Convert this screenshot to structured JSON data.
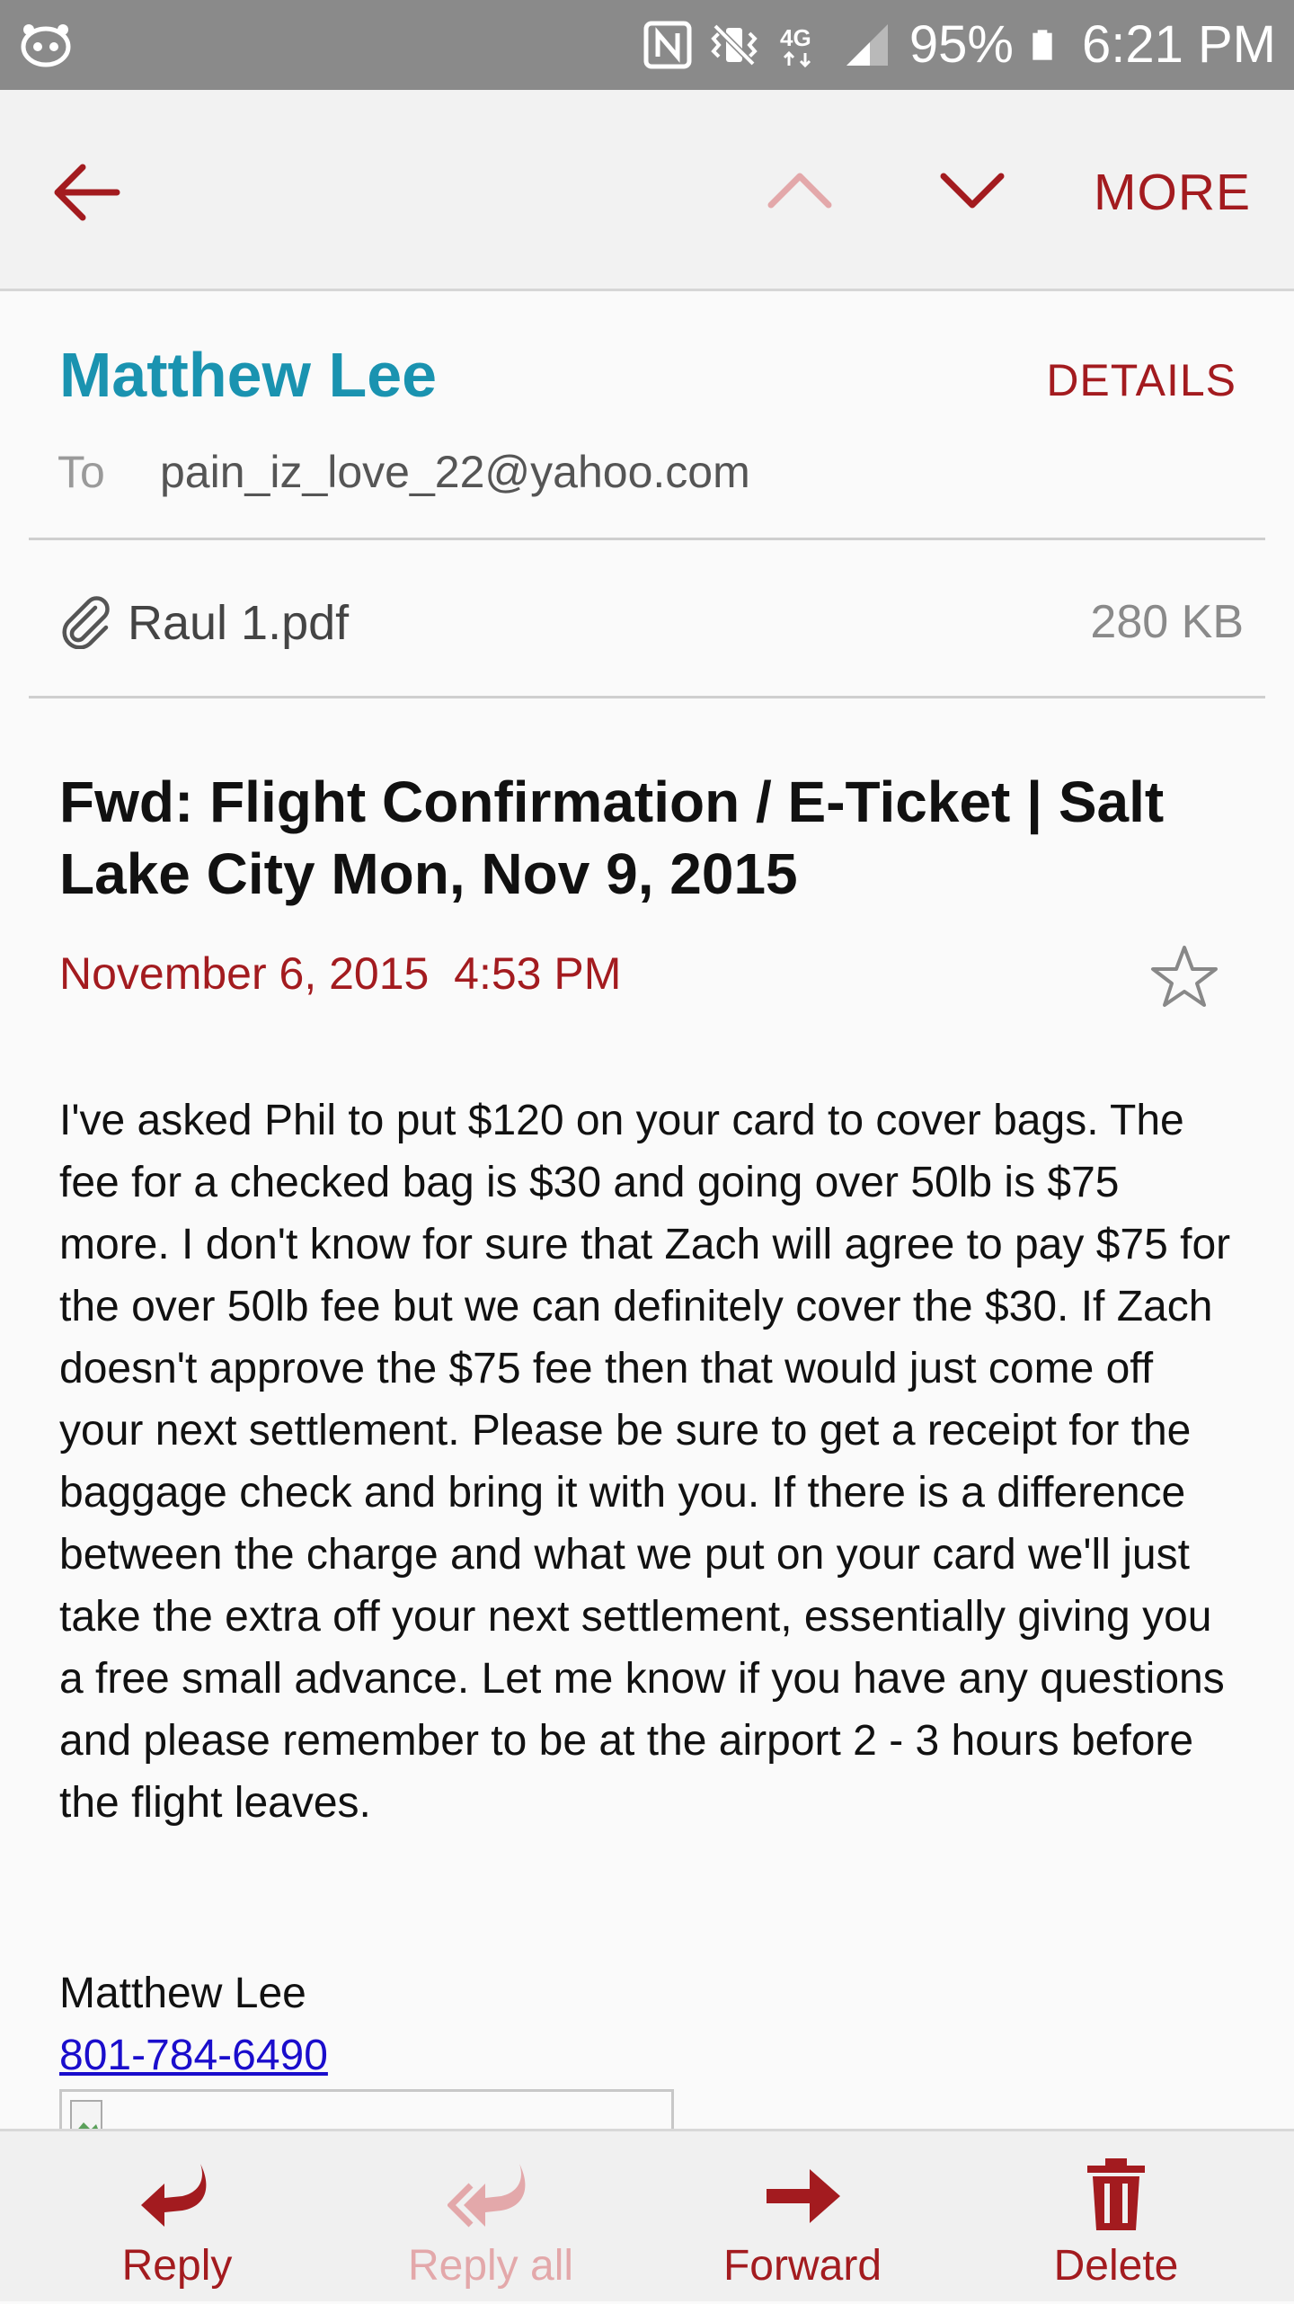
{
  "status_bar": {
    "battery": "95%",
    "time": "6:21 PM",
    "network": "4G",
    "icons": [
      "app-notification-icon",
      "nfc-icon",
      "vibrate-mute-icon",
      "4g-icon",
      "signal-icon",
      "battery-icon"
    ]
  },
  "toolbar": {
    "more_label": "MORE",
    "icons": [
      "back-arrow-icon",
      "chevron-up-icon",
      "chevron-down-icon"
    ]
  },
  "email": {
    "sender": "Matthew Lee",
    "details_label": "DETAILS",
    "to_label": "To",
    "to_address": "pain_iz_love_22@yahoo.com",
    "attachment": {
      "name": "Raul 1.pdf",
      "size": "280 KB"
    },
    "subject": "Fwd: Flight Confirmation / E-Ticket | Salt Lake City Mon, Nov 9, 2015",
    "date": "November 6, 2015  4:53 PM",
    "body": "I've asked Phil to put $120 on your card to cover bags. The fee for a checked bag is $30 and going over 50lb is $75 more. I don't know for sure that Zach will agree to pay $75 for the over 50lb fee but we can definitely cover the $30. If Zach doesn't approve the $75 fee then that would just come off your next settlement. Please be sure to get a receipt for the baggage check and bring it with you. If there is a difference between the charge and what we put on your card we'll just take the extra off your next settlement, essentially giving you a free small advance. Let me know if you have any questions and please remember to be at the airport 2 - 3 hours before the flight leaves.",
    "signature_name": "Matthew Lee",
    "signature_phone": "801-784-6490"
  },
  "bottom_bar": {
    "reply": "Reply",
    "reply_all": "Reply all",
    "forward": "Forward",
    "delete": "Delete"
  },
  "colors": {
    "accent": "#a31b1f",
    "accent_disabled": "#e3a8aa",
    "sender": "#1a93b0",
    "link": "#1a0dcc",
    "status_bar": "#8a8a8a"
  }
}
